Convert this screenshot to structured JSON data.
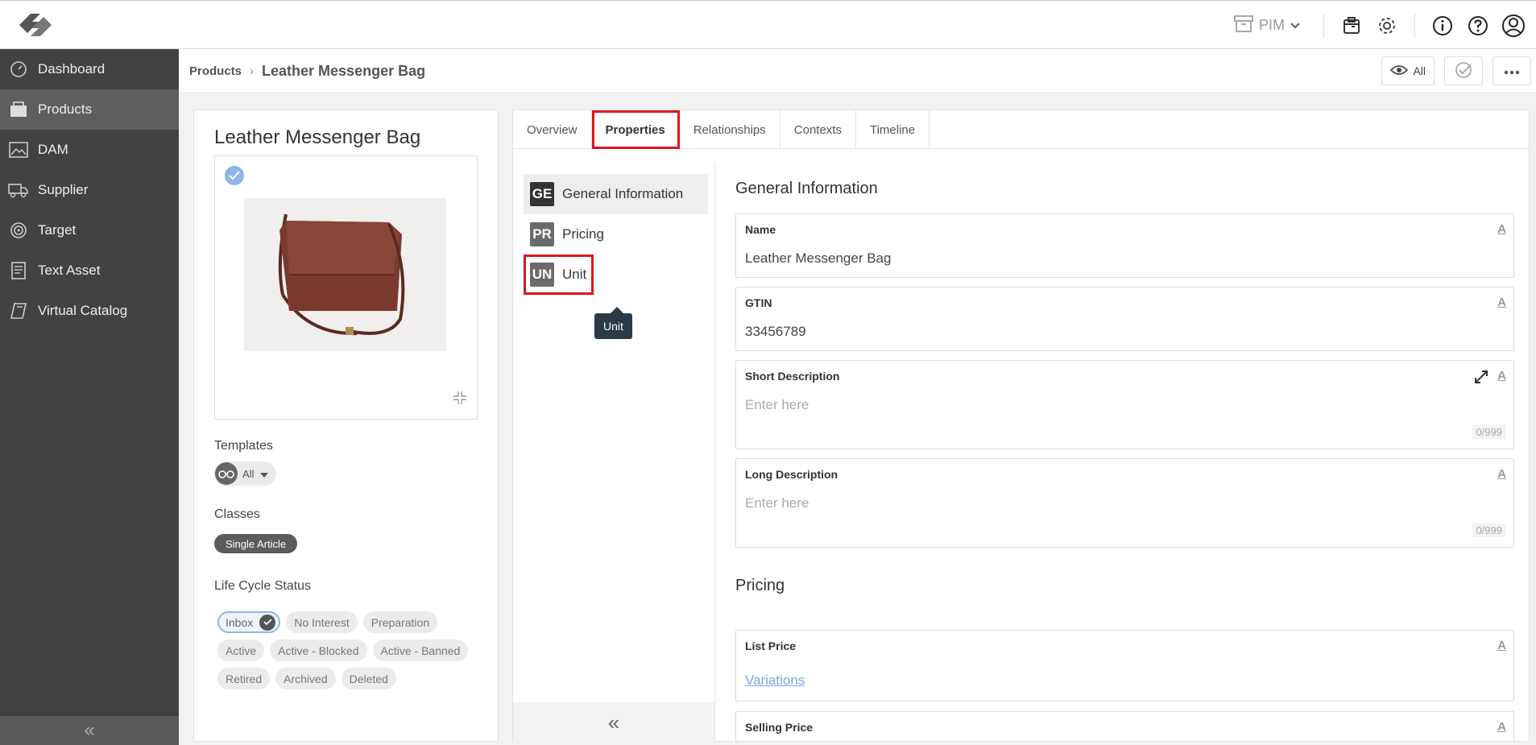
{
  "header": {
    "module_label": "PIM"
  },
  "sidebar": {
    "items": [
      {
        "label": "Dashboard",
        "icon": "dashboard-gauge-icon"
      },
      {
        "label": "Products",
        "icon": "products-box-icon"
      },
      {
        "label": "DAM",
        "icon": "image-icon"
      },
      {
        "label": "Supplier",
        "icon": "truck-icon"
      },
      {
        "label": "Target",
        "icon": "target-icon"
      },
      {
        "label": "Text Asset",
        "icon": "document-icon"
      },
      {
        "label": "Virtual Catalog",
        "icon": "catalog-icon"
      }
    ],
    "collapse_label": "«"
  },
  "breadcrumb": {
    "parent": "Products",
    "separator": "›",
    "current": "Leather Messenger Bag"
  },
  "toolbar": {
    "view_label": "All"
  },
  "product": {
    "title": "Leather Messenger Bag",
    "templates_label": "Templates",
    "template_value": "All",
    "classes_label": "Classes",
    "class_value": "Single Article",
    "lifecycle_label": "Life Cycle Status",
    "statuses": [
      {
        "label": "Inbox",
        "selected": true
      },
      {
        "label": "No Interest",
        "selected": false
      },
      {
        "label": "Preparation",
        "selected": false
      },
      {
        "label": "Active",
        "selected": false
      },
      {
        "label": "Active - Blocked",
        "selected": false
      },
      {
        "label": "Active - Banned",
        "selected": false
      },
      {
        "label": "Retired",
        "selected": false
      },
      {
        "label": "Archived",
        "selected": false
      },
      {
        "label": "Deleted",
        "selected": false
      }
    ]
  },
  "tabs": [
    {
      "label": "Overview"
    },
    {
      "label": "Properties"
    },
    {
      "label": "Relationships"
    },
    {
      "label": "Contexts"
    },
    {
      "label": "Timeline"
    }
  ],
  "groups": [
    {
      "abbr": "GE",
      "label": "General Information",
      "color": "#3a3a3a"
    },
    {
      "abbr": "PR",
      "label": "Pricing",
      "color": "#6b6b6b"
    },
    {
      "abbr": "UN",
      "label": "Unit",
      "color": "#6b6b6b"
    }
  ],
  "tooltip": "Unit",
  "sections": {
    "general": "General Information",
    "pricing": "Pricing"
  },
  "fields": {
    "name": {
      "label": "Name",
      "value": "Leather Messenger Bag",
      "icon": "A"
    },
    "gtin": {
      "label": "GTIN",
      "value": "33456789",
      "icon": "A"
    },
    "short_desc": {
      "label": "Short Description",
      "placeholder": "Enter here",
      "counter": "0/999",
      "icon": "A"
    },
    "long_desc": {
      "label": "Long Description",
      "placeholder": "Enter here",
      "counter": "0/999",
      "icon": "A"
    },
    "list_price": {
      "label": "List Price",
      "link": "Variations",
      "icon": "A"
    },
    "selling_price": {
      "label": "Selling Price",
      "icon": "A"
    }
  },
  "colors": {
    "sidebar_bg": "#424242",
    "highlight_red": "#e0141e",
    "accent_blue": "#8fb6e8"
  }
}
